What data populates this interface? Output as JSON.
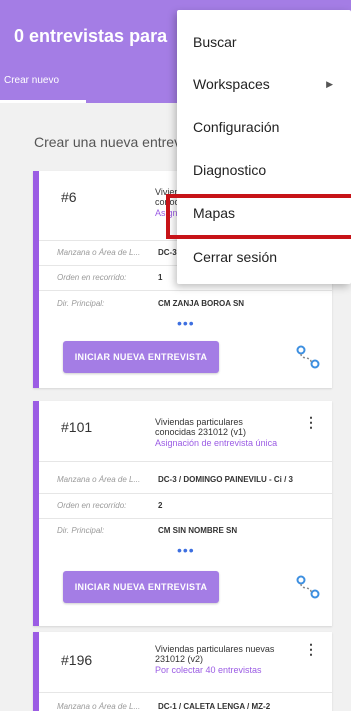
{
  "header": {
    "title": "0 entrevistas para",
    "tab_label": "Crear nuevo"
  },
  "intro_text": "Crear una nueva entrevi",
  "labels": {
    "area": "Manzana o Área de L...",
    "order": "Orden en recorrido:",
    "address": "Dir. Principal:"
  },
  "cards": [
    {
      "number": "#6",
      "desc_line1": "Vivien",
      "desc_line2": "conoc",
      "link": "Asign",
      "area_value": "DC-3",
      "order_value": "1",
      "address_value": "CM ZANJA BOROA SN",
      "more": "•••",
      "button": "INICIAR NUEVA ENTREVISTA"
    },
    {
      "number": "#101",
      "desc_line1": "Viviendas particulares",
      "desc_line2": "conocidas 231012 (v1)",
      "link": "Asignación de entrevista única",
      "area_value": "DC-3 / DOMINGO PAINEVILU - Ci / 3",
      "order_value": "2",
      "address_value": "CM SIN NOMBRE SN",
      "more": "•••",
      "button": "INICIAR NUEVA ENTREVISTA"
    },
    {
      "number": "#196",
      "desc_line1": "Viviendas particulares nuevas",
      "desc_line2": "231012 (v2)",
      "link": "Por colectar 40 entrevistas",
      "area_value": "DC-1 / CALETA LENGA / MZ-2"
    }
  ],
  "menu": {
    "items": [
      "Buscar",
      "Workspaces",
      "Configuración",
      "Diagnostico",
      "Mapas",
      "Cerrar sesión"
    ],
    "submenu_arrow": "▶"
  },
  "colors": {
    "accent": "#a47de5",
    "card_border": "#9b5ce4",
    "link": "#9b5ce4",
    "highlight": "#c71318",
    "more_dots": "#3d6fe0"
  }
}
